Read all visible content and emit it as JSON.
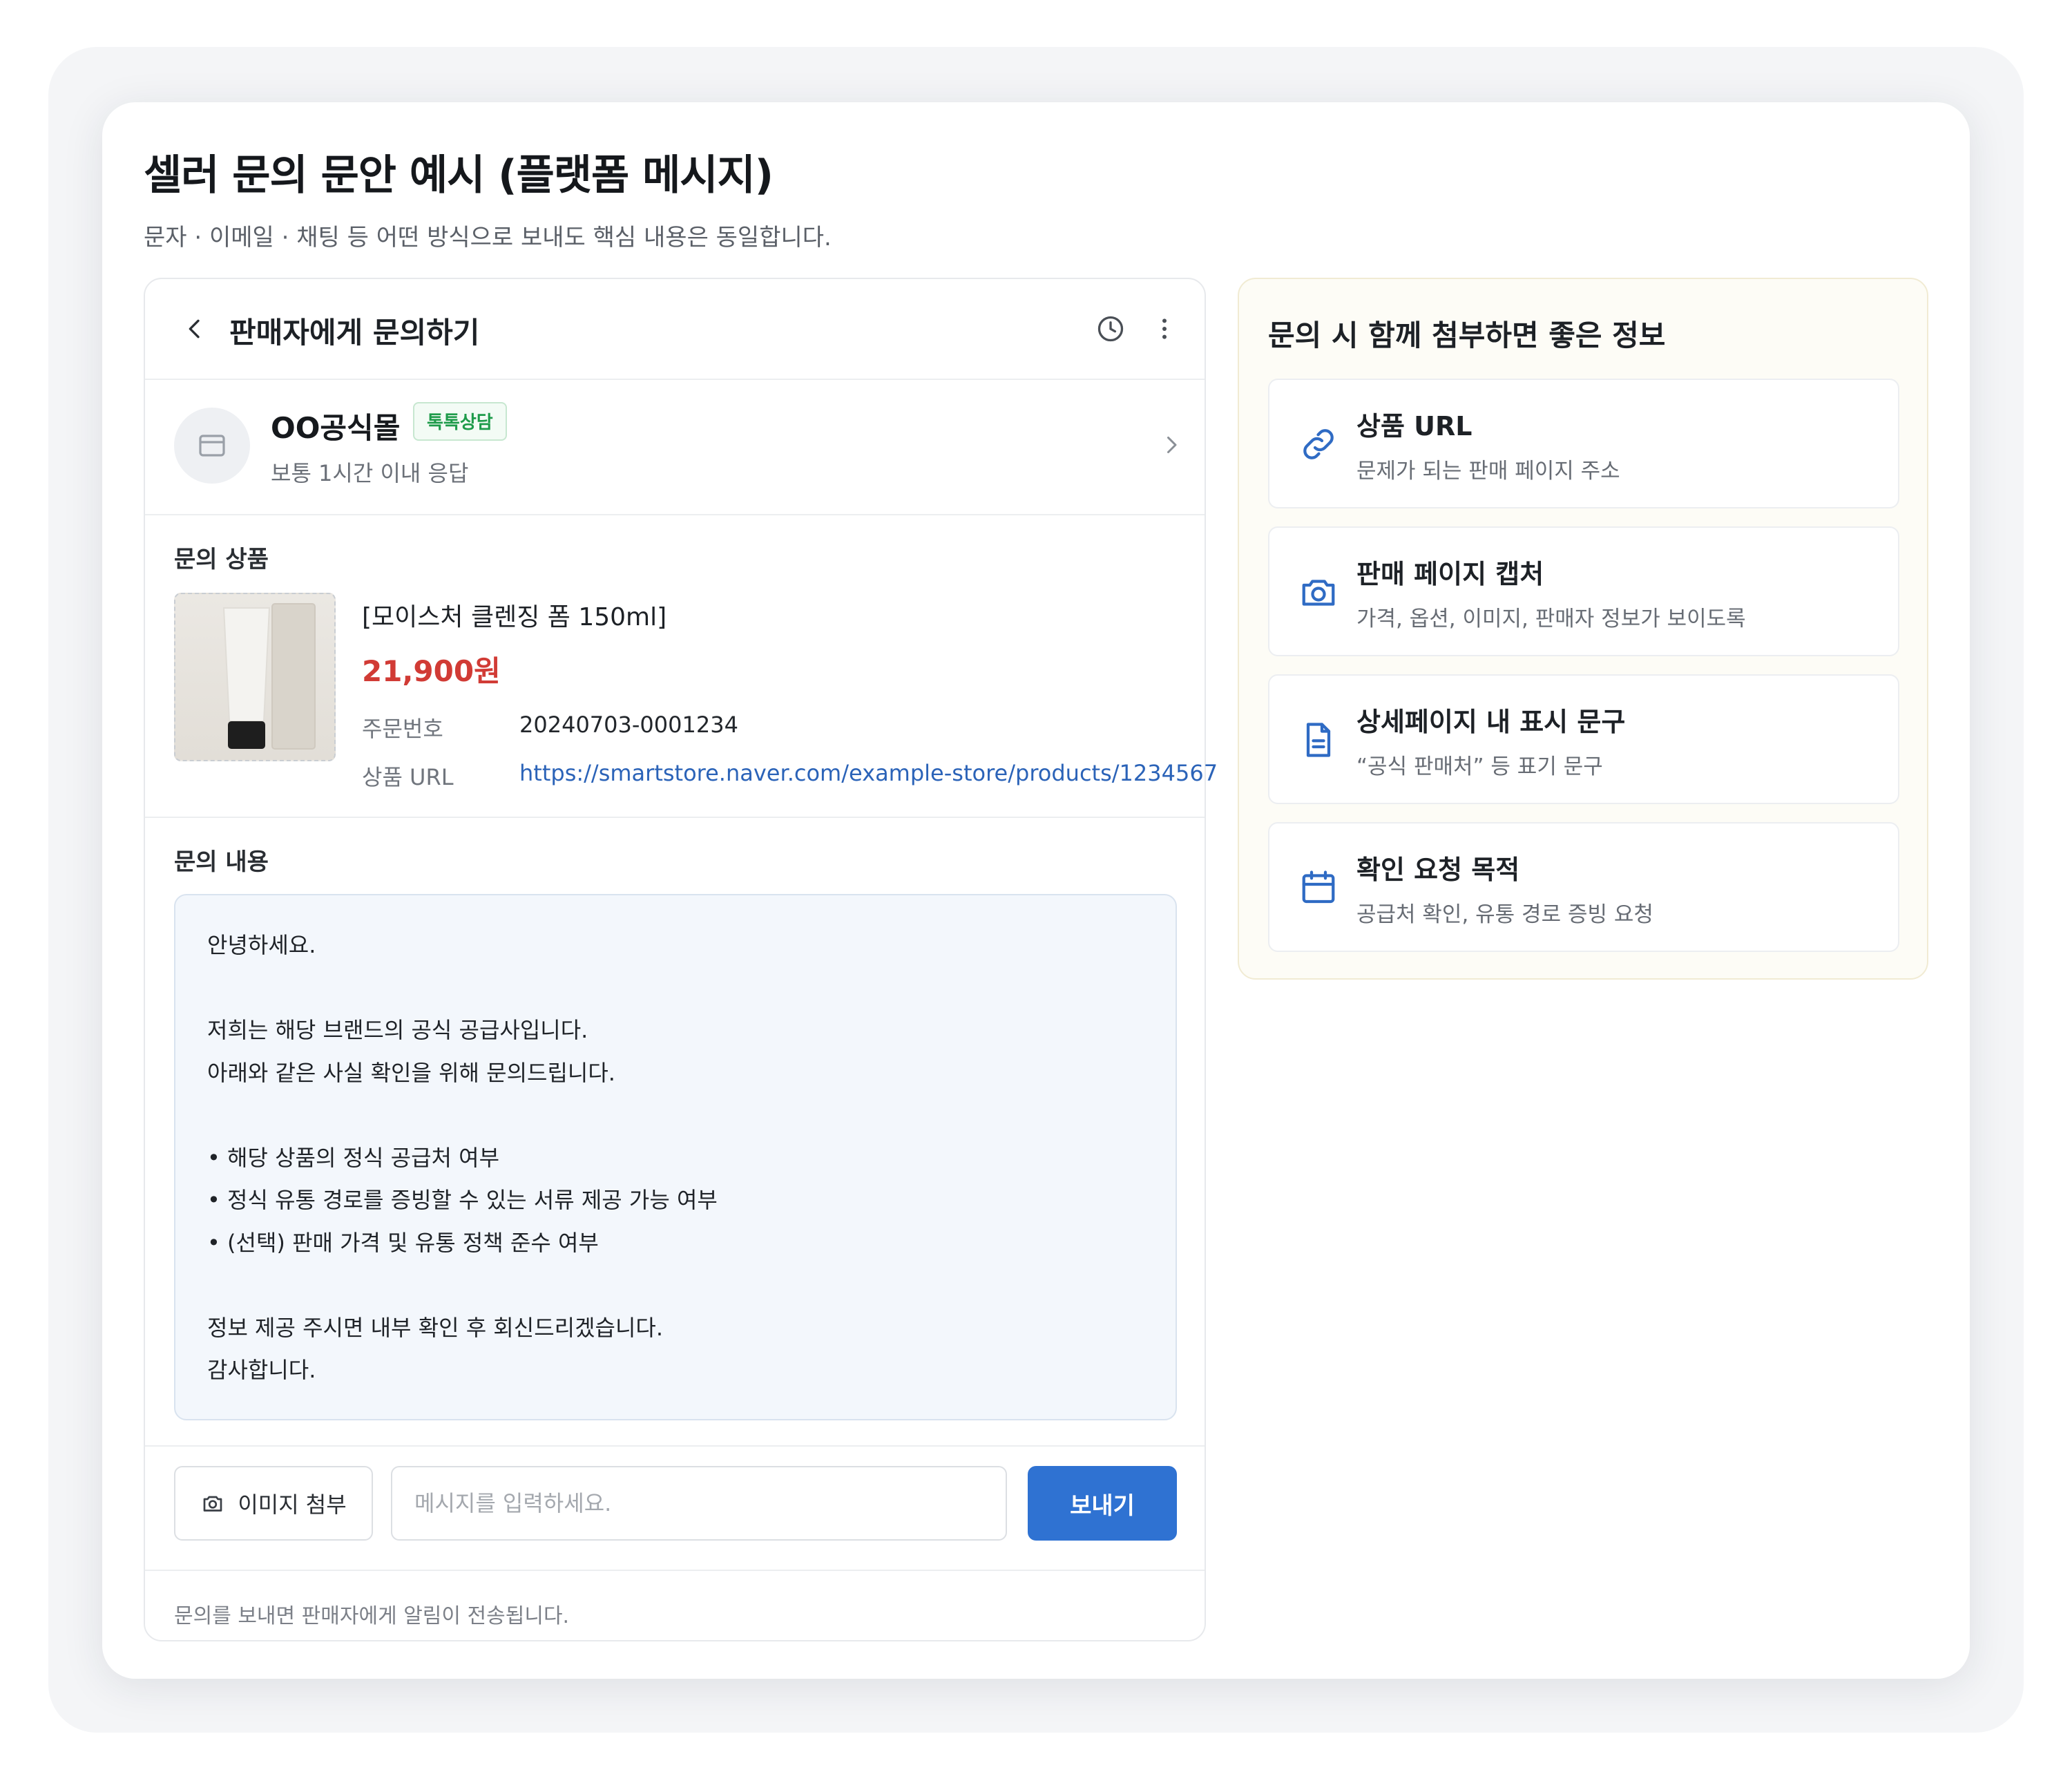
{
  "page": {
    "title": "셀러 문의 문안 예시 (플랫폼 메시지)",
    "subtitle": "문자 · 이메일 · 채팅 등 어떤 방식으로 보내도 핵심 내용은 동일합니다."
  },
  "chat": {
    "title": "판매자에게 문의하기",
    "icons": {
      "back": "chevron-left-icon",
      "history": "clock-icon",
      "more": "more-vertical-icon"
    },
    "seller": {
      "name": "OO공식몰",
      "badge": "톡톡상담",
      "response_time": "보통 1시간 이내 응답",
      "icon": "store-icon"
    },
    "product": {
      "section_label": "문의 상품",
      "name": "[모이스처 클렌징 폼 150ml]",
      "price": "21,900원",
      "order_label": "주문번호",
      "order_number": "20240703-0001234",
      "url_label": "상품 URL",
      "url": "https://smartstore.naver.com/example-store/products/1234567"
    },
    "message": {
      "section_label": "문의 내용",
      "lines": [
        "안녕하세요.",
        "",
        "저희는 해당 브랜드의 공식 공급사입니다.",
        "아래와 같은 사실 확인을 위해 문의드립니다.",
        "",
        "• 해당 상품의 정식 공급처 여부",
        "• 정식 유통 경로를 증빙할 수 있는 서류 제공 가능 여부",
        "• (선택) 판매 가격 및 유통 정책 준수 여부",
        "",
        "정보 제공 주시면 내부 확인 후 회신드리겠습니다.",
        "감사합니다."
      ]
    },
    "composer": {
      "attach_label": "이미지 첨부",
      "input_value": "",
      "input_placeholder": "메시지를 입력하세요.",
      "send_label": "보내기"
    },
    "footer_note": "문의를 보내면 판매자에게 알림이 전송됩니다."
  },
  "tips": {
    "title": "문의 시 함께 첨부하면 좋은 정보",
    "items": [
      {
        "icon": "link-icon",
        "title": "상품 URL",
        "desc": "문제가 되는 판매 페이지 주소"
      },
      {
        "icon": "camera-icon",
        "title": "판매 페이지 캡처",
        "desc": "가격, 옵션, 이미지, 판매자 정보가 보이도록"
      },
      {
        "icon": "document-icon",
        "title": "상세페이지 내 표시 문구",
        "desc": "“공식 판매처” 등 표기 문구"
      },
      {
        "icon": "calendar-icon",
        "title": "확인 요청 목적",
        "desc": "공급처 확인, 유통 경로 증빙 요청"
      }
    ]
  },
  "colors": {
    "accent": "#2f72d2",
    "price": "#d13b35",
    "badge_text": "#1e9b4a",
    "link": "#2b63b8",
    "tips_bg": "#fdfcf6",
    "message_bg": "#f3f7fc"
  }
}
